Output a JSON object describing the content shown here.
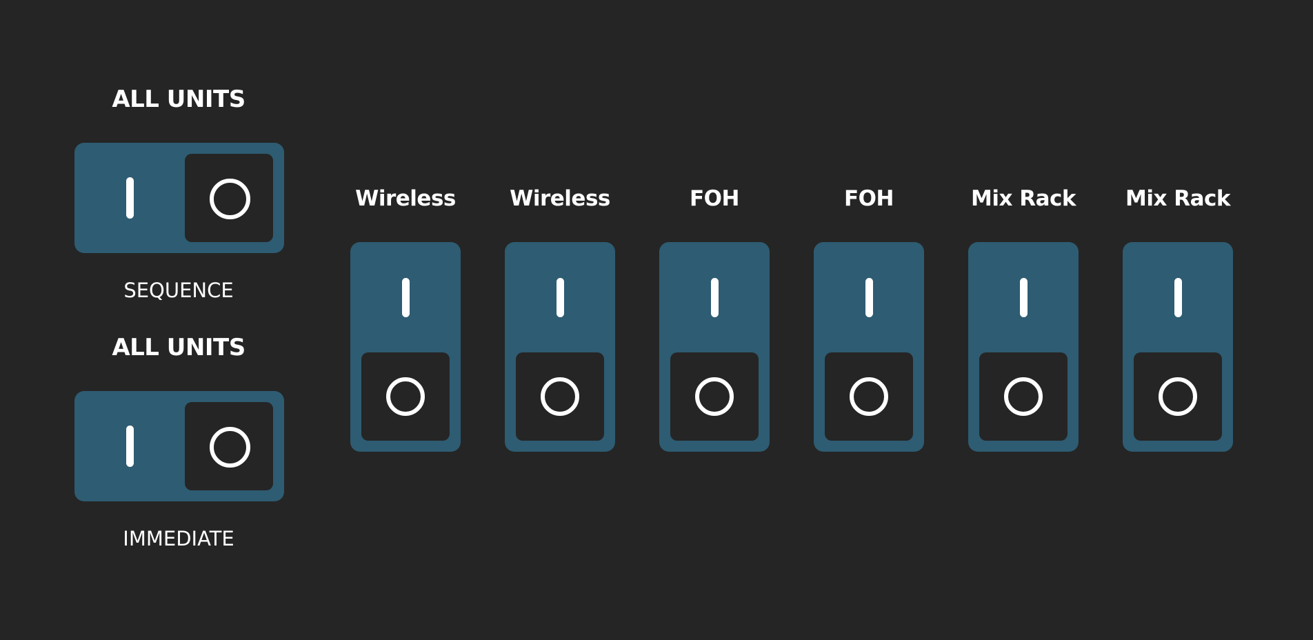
{
  "master": {
    "sequence": {
      "title": "ALL UNITS",
      "caption": "SEQUENCE",
      "state": "off"
    },
    "immediate": {
      "title": "ALL UNITS",
      "caption": "IMMEDIATE",
      "state": "off"
    }
  },
  "units": [
    {
      "label": "Wireless",
      "state": "off"
    },
    {
      "label": "Wireless",
      "state": "off"
    },
    {
      "label": "FOH",
      "state": "off"
    },
    {
      "label": "FOH",
      "state": "off"
    },
    {
      "label": "Mix Rack",
      "state": "off"
    },
    {
      "label": "Mix Rack",
      "state": "off"
    }
  ],
  "icons": {
    "on": "power-on-bar-icon",
    "off": "power-off-ring-icon"
  },
  "colors": {
    "background": "#252525",
    "switch_body": "#2e5c72",
    "switch_pad": "#252525",
    "symbol": "#ffffff"
  }
}
